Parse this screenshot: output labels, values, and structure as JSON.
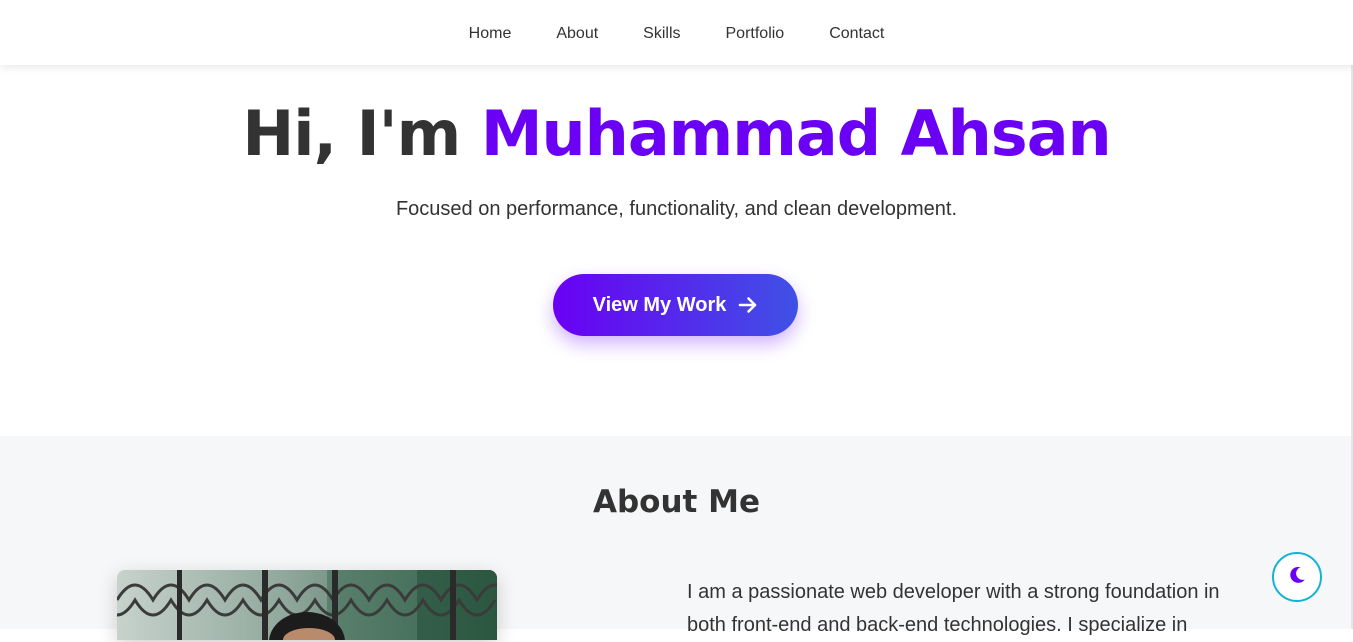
{
  "nav": {
    "items": [
      {
        "label": "Home"
      },
      {
        "label": "About"
      },
      {
        "label": "Skills"
      },
      {
        "label": "Portfolio"
      },
      {
        "label": "Contact"
      }
    ]
  },
  "hero": {
    "greeting": "Hi, I'm ",
    "name": "Muhammad Ahsan",
    "subtitle": "Focused on performance, functionality, and clean development.",
    "cta_label": "View My Work",
    "cta_icon": "arrow-right-icon"
  },
  "about": {
    "title": "About Me",
    "paragraph": "I am a passionate web developer with a strong foundation in both front-end and back-end technologies. I specialize in"
  },
  "theme_toggle": {
    "icon": "moon-icon"
  },
  "colors": {
    "accent": "#6a00f4",
    "gradient_end": "#3f51e6",
    "text": "#333333",
    "section_bg": "#f6f7f9",
    "toggle_border": "#12b4d1"
  }
}
